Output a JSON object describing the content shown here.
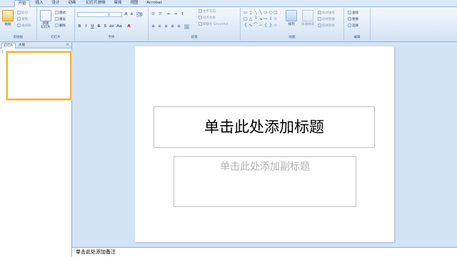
{
  "tabs": [
    "开始",
    "插入",
    "设计",
    "动画",
    "幻灯片放映",
    "审阅",
    "视图",
    "Acrobat"
  ],
  "ribbon": {
    "clipboard": {
      "paste": "粘贴",
      "cut": "剪切",
      "copy": "复制",
      "format_painter": "格式刷",
      "label": "剪贴板"
    },
    "slides": {
      "new_slide": "新建\n幻灯片",
      "layout": "版式",
      "reset": "重设",
      "delete": "删除",
      "label": "幻灯片"
    },
    "font": {
      "label": "字体"
    },
    "paragraph": {
      "text_direction": "文字方向",
      "align_text": "对齐文本",
      "smartart": "转换为 SmartArt",
      "label": "段落"
    },
    "drawing": {
      "arrange": "排列",
      "quick_styles": "快速样式",
      "shape_fill": "形状填充",
      "shape_outline": "形状轮廓",
      "shape_effects": "形状效果",
      "label": "绘图"
    },
    "editing": {
      "find": "查找",
      "replace": "替换",
      "select": "选择",
      "label": "编辑"
    }
  },
  "left_pane": {
    "tabs": [
      "幻灯片",
      "大纲"
    ],
    "close": "×",
    "slide_number": "1"
  },
  "slide": {
    "title_placeholder": "单击此处添加标题",
    "subtitle_placeholder": "单击此处添加副标题"
  },
  "notes": {
    "placeholder": "单击此处添加备注"
  },
  "colors": {
    "ribbon_bg": "#dde9f7",
    "selection_border": "#f3b23c",
    "canvas_bg": "#d3e3f6"
  }
}
